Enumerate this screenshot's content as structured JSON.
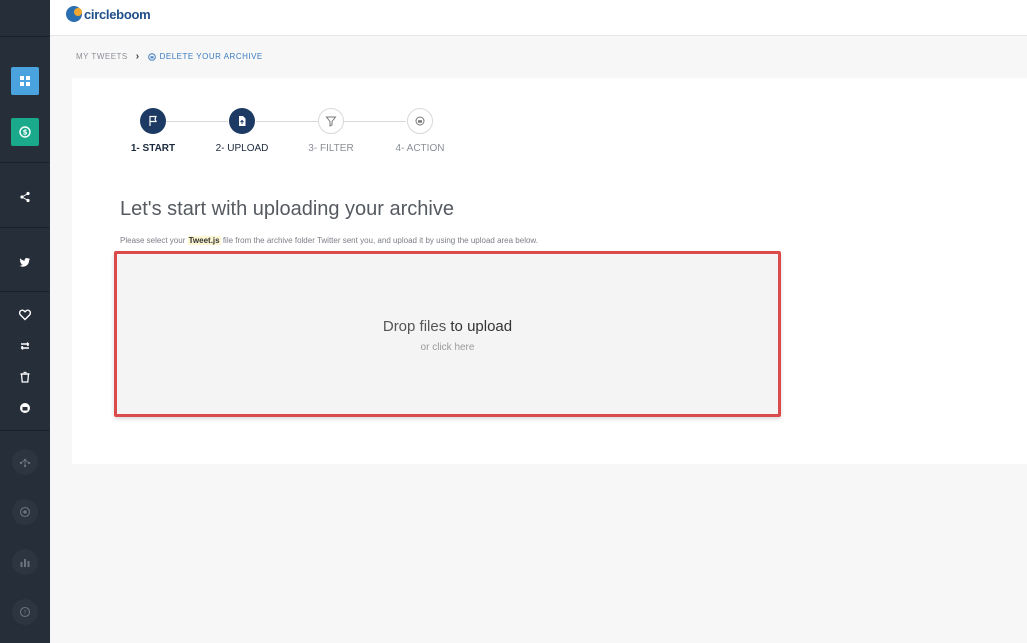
{
  "brand": {
    "name": "circleboom"
  },
  "breadcrumb": {
    "root": "MY TWEETS",
    "current": "DELETE YOUR ARCHIVE"
  },
  "steps": [
    {
      "label": "1- START",
      "state": "done"
    },
    {
      "label": "2- UPLOAD",
      "state": "active"
    },
    {
      "label": "3- FILTER",
      "state": "pending"
    },
    {
      "label": "4- ACTION",
      "state": "pending"
    }
  ],
  "main": {
    "heading": "Let's start with uploading your archive",
    "instruction_pre": "Please select your",
    "instruction_file": "Tweet.js",
    "instruction_post": "file from the archive folder Twitter sent you, and upload it by using the upload area below."
  },
  "dropzone": {
    "title_pre": "Drop files",
    "title_bold": "to upload",
    "subtitle": "or click here"
  },
  "colors": {
    "sidebar": "#262e3a",
    "accent_blue": "#4aa3df",
    "accent_teal": "#1aa98a",
    "step_active": "#1c3a63",
    "highlight_border": "#dc4b4b"
  },
  "sidebar_icons": [
    "dashboard-icon",
    "dollar-icon",
    "share-icon",
    "twitter-icon",
    "heart-icon",
    "retweet-icon",
    "trash-icon",
    "archive-icon",
    "network-icon",
    "circle-icon",
    "chart-icon",
    "help-icon"
  ]
}
